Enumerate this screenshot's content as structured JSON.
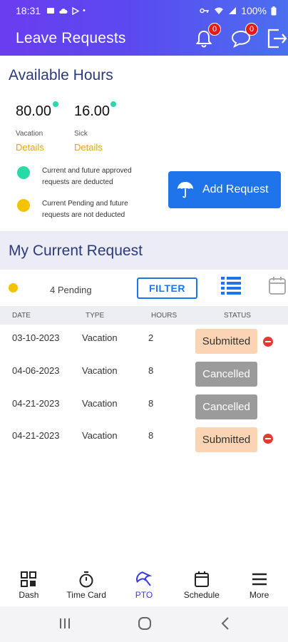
{
  "status_bar": {
    "time": "18:31",
    "battery": "100%"
  },
  "header": {
    "title": "Leave Requests",
    "notifications_count": "0",
    "messages_count": "0"
  },
  "available_hours": {
    "title": "Available Hours",
    "vacation": {
      "value": "80.00",
      "label": "Vacation",
      "details": "Details"
    },
    "sick": {
      "value": "16.00",
      "label": "Sick",
      "details": "Details"
    },
    "legend": {
      "green": "Current and future approved requests are deducted",
      "yellow": "Current Pending and future requests are not deducted"
    },
    "add_request_label": "Add Request"
  },
  "current_request": {
    "title": "My Current Request",
    "pending_label": "4 Pending",
    "filter_label": "FILTER"
  },
  "table": {
    "headers": [
      "DATE",
      "TYPE",
      "HOURS",
      "STATUS"
    ],
    "rows": [
      {
        "date": "03-10-2023",
        "type": "Vacation",
        "hours": "2",
        "status": "Submitted"
      },
      {
        "date": "04-06-2023",
        "type": "Vacation",
        "hours": "8",
        "status": "Cancelled"
      },
      {
        "date": "04-21-2023",
        "type": "Vacation",
        "hours": "8",
        "status": "Cancelled"
      },
      {
        "date": "04-21-2023",
        "type": "Vacation",
        "hours": "8",
        "status": "Submitted"
      }
    ]
  },
  "bottom_nav": {
    "items": [
      {
        "label": "Dash",
        "icon": "dashboard-icon"
      },
      {
        "label": "Time Card",
        "icon": "stopwatch-icon"
      },
      {
        "label": "PTO",
        "icon": "umbrella-icon"
      },
      {
        "label": "Schedule",
        "icon": "calendar-icon"
      },
      {
        "label": "More",
        "icon": "menu-icon"
      }
    ]
  },
  "colors": {
    "accent": "#1f74ec",
    "header_start": "#6a3df0",
    "header_end": "#4b6ff0",
    "approved_dot": "#2ad9a8",
    "pending_dot": "#f3c300",
    "submitted_bg": "#fbd5b3",
    "cancelled_bg": "#9b9b9b"
  }
}
